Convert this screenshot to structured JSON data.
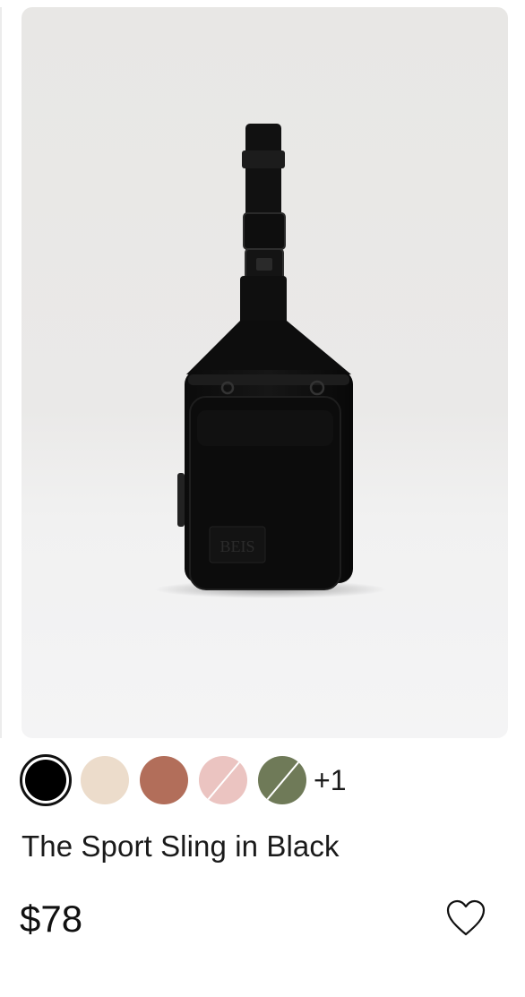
{
  "product": {
    "name": "The Sport Sling in Black",
    "price": "$78",
    "image_alt": "The Sport Sling in Black",
    "image_logo_text": "BEIS"
  },
  "swatches": {
    "items": [
      {
        "name": "black",
        "color": "#000000",
        "selected": true,
        "unavailable": false
      },
      {
        "name": "beige",
        "color": "#ecdccb",
        "selected": false,
        "unavailable": false
      },
      {
        "name": "terracotta",
        "color": "#b26e5a",
        "selected": false,
        "unavailable": false
      },
      {
        "name": "pink",
        "color": "#ebc4c1",
        "selected": false,
        "unavailable": true
      },
      {
        "name": "olive",
        "color": "#6f7a58",
        "selected": false,
        "unavailable": true
      }
    ],
    "more_label": "+1"
  },
  "icons": {
    "wishlist": "heart-outline-icon"
  }
}
